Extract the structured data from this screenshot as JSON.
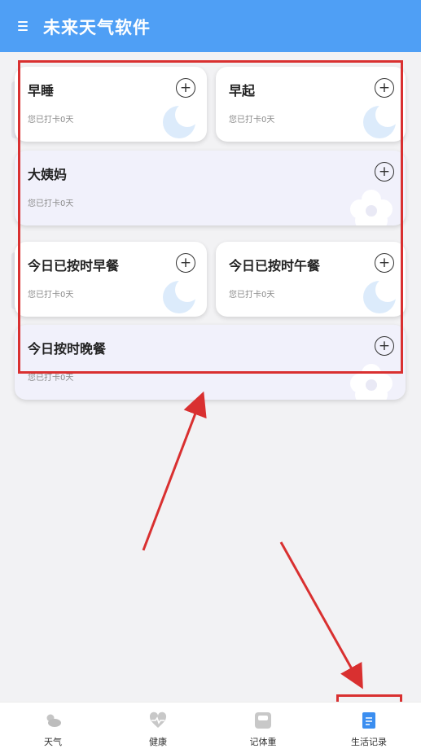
{
  "app": {
    "title": "未来天气软件"
  },
  "cards": [
    {
      "title": "早睡",
      "sub": "您已打卡0天"
    },
    {
      "title": "早起",
      "sub": "您已打卡0天"
    },
    {
      "title": "大姨妈",
      "sub": "您已打卡0天"
    },
    {
      "title": "今日已按时早餐",
      "sub": "您已打卡0天"
    },
    {
      "title": "今日已按时午餐",
      "sub": "您已打卡0天"
    },
    {
      "title": "今日按时晚餐",
      "sub": "您已打卡0天"
    }
  ],
  "plus_glyph": "+",
  "nav": [
    {
      "label": "天气",
      "icon": "weather-icon"
    },
    {
      "label": "健康",
      "icon": "heart-pulse-icon"
    },
    {
      "label": "记体重",
      "icon": "scale-icon"
    },
    {
      "label": "生活记录",
      "icon": "document-icon",
      "active": true
    }
  ],
  "colors": {
    "header": "#4f9ff5",
    "accent": "#3b8ef0",
    "annotation": "#d93030"
  }
}
